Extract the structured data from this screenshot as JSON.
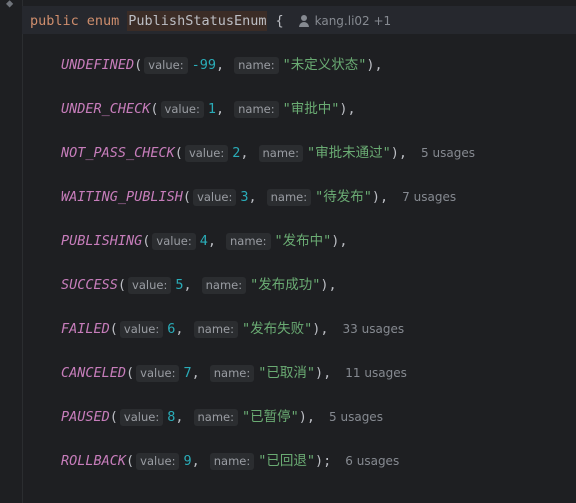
{
  "header": {
    "kw_public": "public",
    "kw_enum": "enum",
    "class_name": "PublishStatusEnum",
    "brace": "{",
    "author": "kang.li02 +1"
  },
  "hint_labels": {
    "value": "value:",
    "name": "name:"
  },
  "constants": [
    {
      "id": "undefined",
      "name": "UNDEFINED",
      "value": "-99",
      "label": "\"未定义状态\"",
      "tail": "),",
      "usages": ""
    },
    {
      "id": "under-check",
      "name": "UNDER_CHECK",
      "value": "1",
      "label": "\"审批中\"",
      "tail": "),",
      "usages": ""
    },
    {
      "id": "not-pass-check",
      "name": "NOT_PASS_CHECK",
      "value": "2",
      "label": "\"审批未通过\"",
      "tail": "),",
      "usages": "5 usages"
    },
    {
      "id": "waiting-publish",
      "name": "WAITING_PUBLISH",
      "value": "3",
      "label": "\"待发布\"",
      "tail": "),",
      "usages": "7 usages"
    },
    {
      "id": "publishing",
      "name": "PUBLISHING",
      "value": "4",
      "label": "\"发布中\"",
      "tail": "),",
      "usages": ""
    },
    {
      "id": "success",
      "name": "SUCCESS",
      "value": "5",
      "label": "\"发布成功\"",
      "tail": "),",
      "usages": ""
    },
    {
      "id": "failed",
      "name": "FAILED",
      "value": "6",
      "label": "\"发布失败\"",
      "tail": "),",
      "usages": "33 usages"
    },
    {
      "id": "canceled",
      "name": "CANCELED",
      "value": "7",
      "label": "\"已取消\"",
      "tail": "),",
      "usages": "11 usages"
    },
    {
      "id": "paused",
      "name": "PAUSED",
      "value": "8",
      "label": "\"已暂停\"",
      "tail": "),",
      "usages": "5 usages"
    },
    {
      "id": "rollback",
      "name": "ROLLBACK",
      "value": "9",
      "label": "\"已回退\"",
      "tail": ");",
      "usages": "6 usages"
    }
  ],
  "punctuation": {
    "open": "(",
    "comma": ","
  },
  "colors": {
    "background": "#1e1f22",
    "keyword": "#cf8e6d",
    "constant": "#c77dbb",
    "number": "#2aacb8",
    "string": "#6aab73",
    "hint_bg": "#2b2d30"
  }
}
